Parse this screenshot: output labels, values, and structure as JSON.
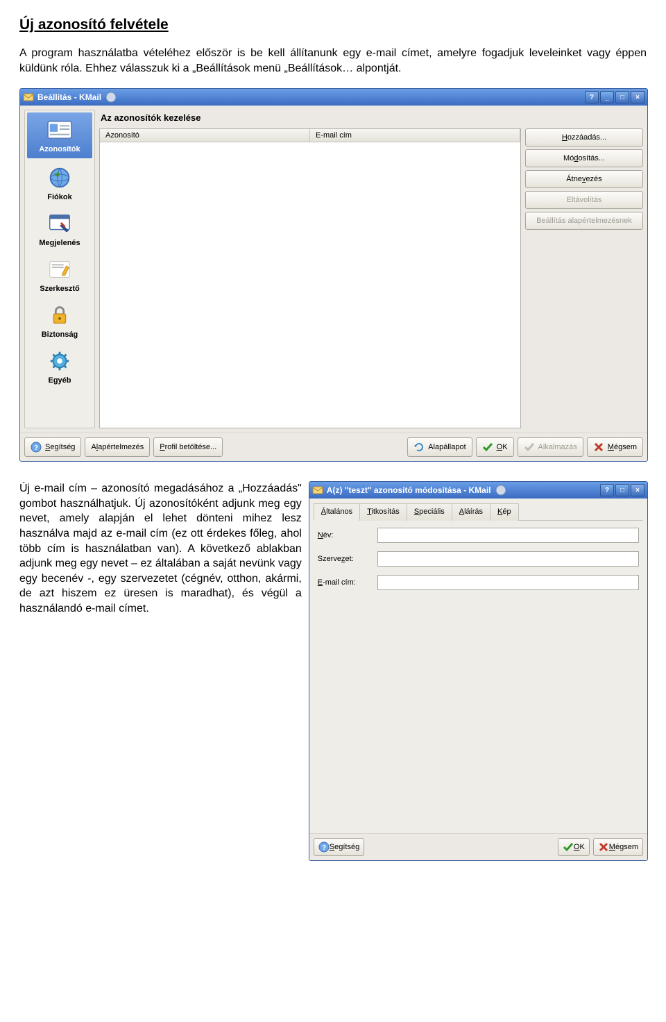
{
  "title": "Új azonosító felvétele",
  "intro": "A program használatba vételéhez először is be kell állítanunk egy e-mail címet, amelyre fogadjuk leveleinket vagy éppen küldünk róla. Ehhez válasszuk ki a „Beállítások menü „Beállítások… alpontját.",
  "second_para": "Új e-mail cím – azonosító megadásához a „Hozzáadás\" gombot használhatjuk. Új azonosítóként adjunk meg egy nevet, amely alapján el lehet dönteni mihez lesz használva majd az e-mail cím (ez ott érdekes főleg, ahol több cím is használatban van). A következő ablakban adjunk meg egy nevet – ez általában a saját nevünk vagy egy becenév -, egy szervezetet (cégnév, otthon, akármi, de azt hiszem ez üresen is maradhat), és végül a használandó e-mail címet.",
  "win1": {
    "title": "Beállítás - KMail",
    "content_title": "Az azonosítók kezelése",
    "sidebar": {
      "items": [
        {
          "label": "Azonosítók"
        },
        {
          "label": "Fiókok"
        },
        {
          "label": "Megjelenés"
        },
        {
          "label": "Szerkesztő"
        },
        {
          "label": "Biztonság"
        },
        {
          "label": "Egyéb"
        }
      ]
    },
    "list_cols": {
      "c1": "Azonosító",
      "c2": "E-mail cím"
    },
    "buttons": {
      "add": "Hozzáadás...",
      "modify": "Módosítás...",
      "rename": "Átnevezés",
      "remove": "Eltávolítás",
      "default": "Beállítás alapértelmezésnek"
    },
    "footer": {
      "help": "Segítség",
      "defaults": "Alapértelmezés",
      "profile": "Profil betöltése...",
      "reset": "Alapállapot",
      "ok": "OK",
      "apply": "Alkalmazás",
      "cancel": "Mégsem"
    }
  },
  "win2": {
    "title": "A(z) \"teszt\" azonosító módosítása - KMail",
    "tabs": {
      "t1": "Általános",
      "t2": "Titkosítás",
      "t3": "Speciális",
      "t4": "Aláírás",
      "t5": "Kép"
    },
    "form": {
      "name": "Név:",
      "org": "Szervezet:",
      "email": "E-mail cím:"
    },
    "footer": {
      "help": "Segítség",
      "ok": "OK",
      "cancel": "Mégsem"
    }
  }
}
